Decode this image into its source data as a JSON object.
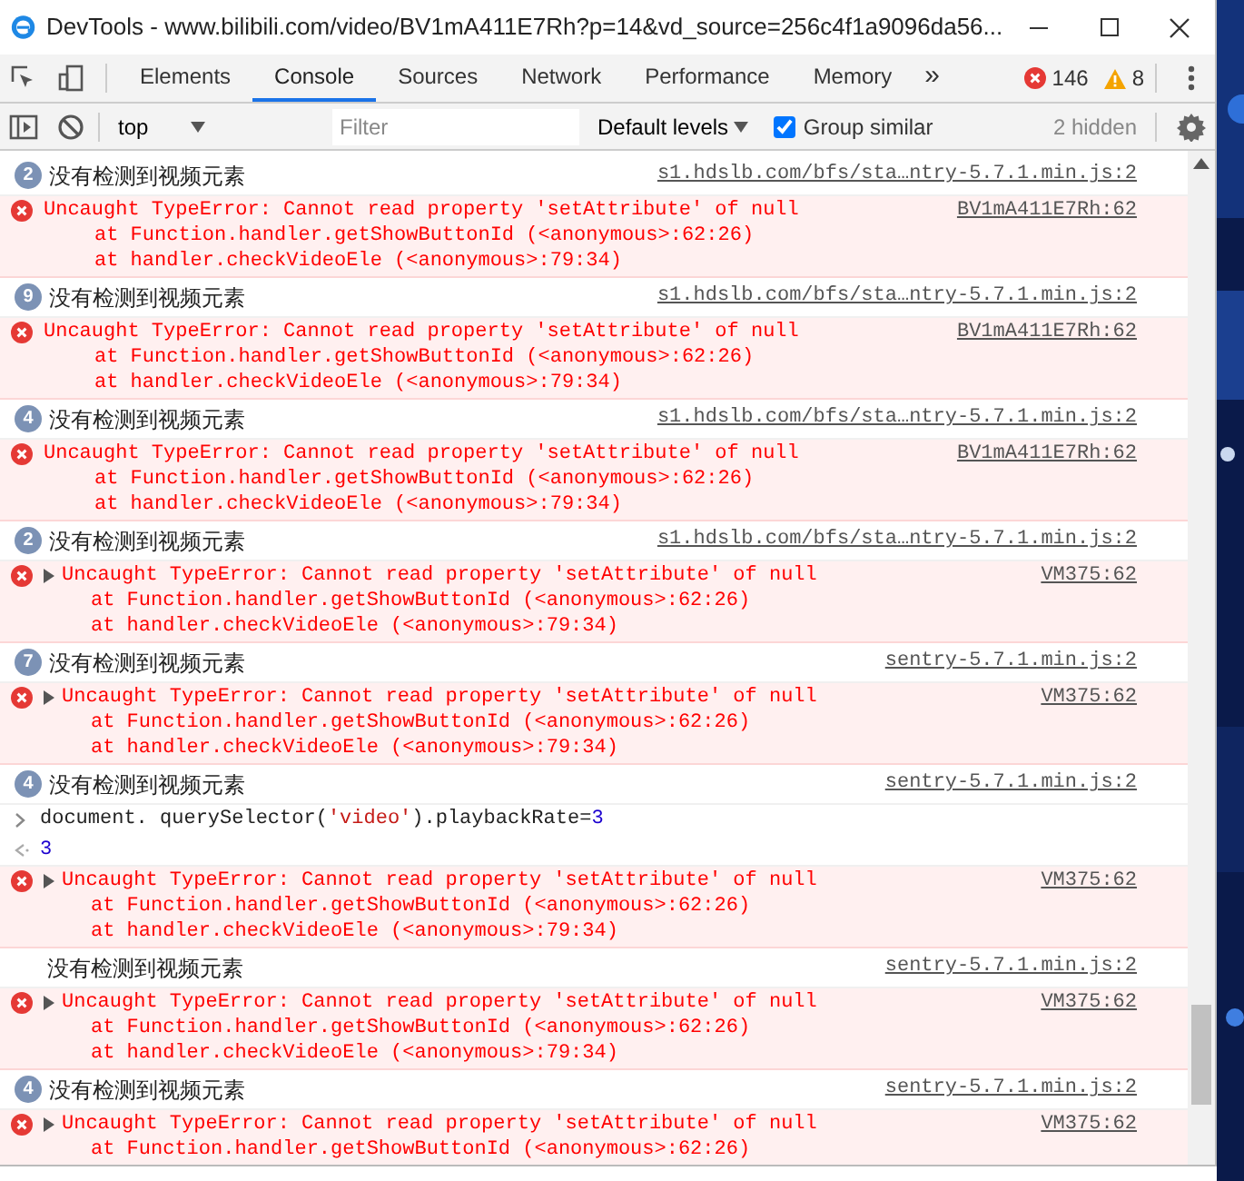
{
  "window": {
    "title": "DevTools - www.bilibili.com/video/BV1mA411E7Rh?p=14&vd_source=256c4f1a9096da56..."
  },
  "tabs": [
    {
      "label": "Elements",
      "selected": false
    },
    {
      "label": "Console",
      "selected": true
    },
    {
      "label": "Sources",
      "selected": false
    },
    {
      "label": "Network",
      "selected": false
    },
    {
      "label": "Performance",
      "selected": false
    },
    {
      "label": "Memory",
      "selected": false
    }
  ],
  "more_tabs": "»",
  "counters": {
    "errors": "146",
    "warnings": "8"
  },
  "toolbar": {
    "context": "top",
    "filter": {
      "placeholder": "Filter"
    },
    "levels": "Default levels",
    "group_similar": {
      "label": "Group similar",
      "checked": true
    },
    "hidden": "2 hidden"
  },
  "entries": [
    {
      "kind": "log",
      "count": "2",
      "text": "没有检测到视频元素",
      "source": "s1.hdslb.com/bfs/sta…ntry-5.7.1.min.js:2"
    },
    {
      "kind": "error",
      "expandable": false,
      "lines": [
        "Uncaught TypeError: Cannot read property 'setAttribute' of null",
        "at Function.handler.getShowButtonId (<anonymous>:62:26)",
        "at handler.checkVideoEle (<anonymous>:79:34)"
      ],
      "source": "BV1mA411E7Rh:62"
    },
    {
      "kind": "log",
      "count": "9",
      "text": "没有检测到视频元素",
      "source": "s1.hdslb.com/bfs/sta…ntry-5.7.1.min.js:2"
    },
    {
      "kind": "error",
      "expandable": false,
      "lines": [
        "Uncaught TypeError: Cannot read property 'setAttribute' of null",
        "at Function.handler.getShowButtonId (<anonymous>:62:26)",
        "at handler.checkVideoEle (<anonymous>:79:34)"
      ],
      "source": "BV1mA411E7Rh:62"
    },
    {
      "kind": "log",
      "count": "4",
      "text": "没有检测到视频元素",
      "source": "s1.hdslb.com/bfs/sta…ntry-5.7.1.min.js:2"
    },
    {
      "kind": "error",
      "expandable": false,
      "lines": [
        "Uncaught TypeError: Cannot read property 'setAttribute' of null",
        "at Function.handler.getShowButtonId (<anonymous>:62:26)",
        "at handler.checkVideoEle (<anonymous>:79:34)"
      ],
      "source": "BV1mA411E7Rh:62"
    },
    {
      "kind": "log",
      "count": "2",
      "text": "没有检测到视频元素",
      "source": "s1.hdslb.com/bfs/sta…ntry-5.7.1.min.js:2"
    },
    {
      "kind": "error",
      "expandable": true,
      "lines": [
        "Uncaught TypeError: Cannot read property 'setAttribute' of null",
        "at Function.handler.getShowButtonId (<anonymous>:62:26)",
        "at handler.checkVideoEle (<anonymous>:79:34)"
      ],
      "source": "VM375:62"
    },
    {
      "kind": "log",
      "count": "7",
      "text": "没有检测到视频元素",
      "source": "sentry-5.7.1.min.js:2"
    },
    {
      "kind": "error",
      "expandable": true,
      "lines": [
        "Uncaught TypeError: Cannot read property 'setAttribute' of null",
        "at Function.handler.getShowButtonId (<anonymous>:62:26)",
        "at handler.checkVideoEle (<anonymous>:79:34)"
      ],
      "source": "VM375:62"
    },
    {
      "kind": "log",
      "count": "4",
      "text": "没有检测到视频元素",
      "source": "sentry-5.7.1.min.js:2"
    },
    {
      "kind": "input",
      "parts": [
        {
          "kind": "plain",
          "text": "document. querySelector("
        },
        {
          "kind": "string",
          "text": "'video'"
        },
        {
          "kind": "plain",
          "text": ").playbackRate="
        },
        {
          "kind": "number",
          "text": "3"
        }
      ]
    },
    {
      "kind": "result",
      "text": "3"
    },
    {
      "kind": "error",
      "expandable": true,
      "lines": [
        "Uncaught TypeError: Cannot read property 'setAttribute' of null",
        "at Function.handler.getShowButtonId (<anonymous>:62:26)",
        "at handler.checkVideoEle (<anonymous>:79:34)"
      ],
      "source": "VM375:62"
    },
    {
      "kind": "log",
      "text": "没有检测到视频元素",
      "source": "sentry-5.7.1.min.js:2"
    },
    {
      "kind": "error",
      "expandable": true,
      "lines": [
        "Uncaught TypeError: Cannot read property 'setAttribute' of null",
        "at Function.handler.getShowButtonId (<anonymous>:62:26)",
        "at handler.checkVideoEle (<anonymous>:79:34)"
      ],
      "source": "VM375:62"
    },
    {
      "kind": "log",
      "count": "4",
      "text": "没有检测到视频元素",
      "source": "sentry-5.7.1.min.js:2"
    },
    {
      "kind": "error",
      "expandable": true,
      "lines": [
        "Uncaught TypeError: Cannot read property 'setAttribute' of null",
        "at Function.handler.getShowButtonId (<anonymous>:62:26)"
      ],
      "source": "VM375:62"
    }
  ]
}
